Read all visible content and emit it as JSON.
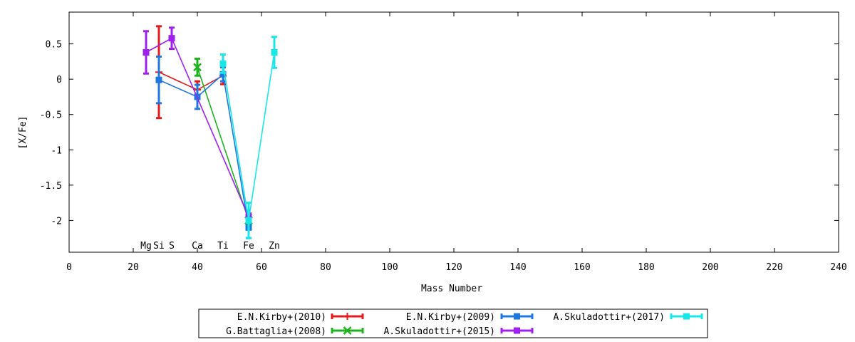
{
  "chart_data": {
    "type": "line",
    "title": "",
    "xlabel": "Mass Number",
    "ylabel": "[X/Fe]",
    "xlim": [
      0,
      240
    ],
    "ylim": [
      -2.45,
      0.95
    ],
    "xticks": [
      0,
      20,
      40,
      60,
      80,
      100,
      120,
      140,
      160,
      180,
      200,
      220,
      240
    ],
    "yticks": [
      0.5,
      0,
      -0.5,
      -1,
      -1.5,
      -2
    ],
    "ytick_labels": [
      "0.5",
      "0",
      "-0.5",
      "-1",
      "-1.5",
      "-2"
    ],
    "grid": false,
    "legend_position": "bottom",
    "element_labels": [
      {
        "text": "Mg",
        "x": 24
      },
      {
        "text": "Si",
        "x": 28
      },
      {
        "text": "S",
        "x": 32
      },
      {
        "text": "Ca",
        "x": 40
      },
      {
        "text": "Ti",
        "x": 48
      },
      {
        "text": "Fe",
        "x": 56
      },
      {
        "text": "Zn",
        "x": 64
      }
    ],
    "series": [
      {
        "name": "E.N.Kirby+(2010)",
        "color": "#e41a1c",
        "marker": "plus",
        "points": [
          {
            "x": 28,
            "y": 0.1,
            "err": 0.65
          },
          {
            "x": 40,
            "y": -0.15,
            "err": 0.12
          },
          {
            "x": 48,
            "y": 0.05,
            "err": 0.12
          }
        ]
      },
      {
        "name": "G.Battaglia+(2008)",
        "color": "#1db31d",
        "marker": "cross",
        "points": [
          {
            "x": 40,
            "y": 0.17,
            "err": 0.12
          },
          {
            "x": 56,
            "y": -2.0,
            "err": 0.05
          }
        ]
      },
      {
        "name": "E.N.Kirby+(2009)",
        "color": "#1f78e0",
        "marker": "square",
        "points": [
          {
            "x": 28,
            "y": -0.01,
            "err": 0.33
          },
          {
            "x": 40,
            "y": -0.25,
            "err": 0.17
          },
          {
            "x": 48,
            "y": 0.07,
            "err": 0.1
          },
          {
            "x": 56,
            "y": -2.1,
            "err": 0.15
          }
        ]
      },
      {
        "name": "A.Skuladottir+(2015)",
        "color": "#a020f0",
        "marker": "filled-square",
        "points": [
          {
            "x": 24,
            "y": 0.38,
            "err": 0.3
          },
          {
            "x": 32,
            "y": 0.58,
            "err": 0.15
          },
          {
            "x": 56,
            "y": -1.95,
            "err": 0.05
          }
        ]
      },
      {
        "name": "A.Skuladottir+(2017)",
        "color": "#19e6e6",
        "marker": "filled-square",
        "points": [
          {
            "x": 48,
            "y": 0.22,
            "err": 0.13
          },
          {
            "x": 56,
            "y": -2.0,
            "err": 0.25
          },
          {
            "x": 64,
            "y": 0.38,
            "err": 0.22
          }
        ]
      }
    ],
    "legend_order": [
      0,
      2,
      4,
      1,
      3
    ]
  }
}
